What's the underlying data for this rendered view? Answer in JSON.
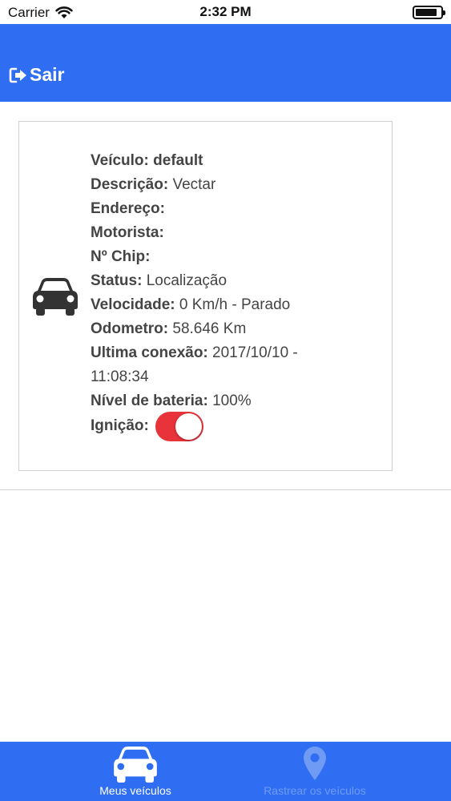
{
  "status_bar": {
    "carrier": "Carrier",
    "time": "2:32 PM",
    "battery_level": 0.85
  },
  "header": {
    "exit_label": "Sair",
    "background": "#2f6ef2"
  },
  "vehicle": {
    "name_label": "Veículo:",
    "name_value": "default",
    "description_label": "Descrição:",
    "description_value": "Vectar",
    "address_label": "Endereço:",
    "driver_label": "Motorista:",
    "chip_label": "Nº Chip:",
    "status_label": "Status:",
    "status_value": "Localização",
    "speed_label": "Velocidade:",
    "speed_value": "0 Km/h - Parado",
    "odometer_label": "Odometro:",
    "odometer_value": "58.646 Km",
    "last_connection_label": "Ultima conexão:",
    "last_connection_value": "2017/10/10 - 11:08:34",
    "battery_label": "Nível de bateria:",
    "battery_value": "100%",
    "ignition_label": "Ignição:",
    "ignition_on": true,
    "ignition_color": "#e8333a"
  },
  "tabbar": {
    "tab_vehicles": "Meus veículos",
    "tab_track": "Rastrear os veículos",
    "active_color": "#ffffff",
    "inactive_color": "#6f9bf5"
  }
}
